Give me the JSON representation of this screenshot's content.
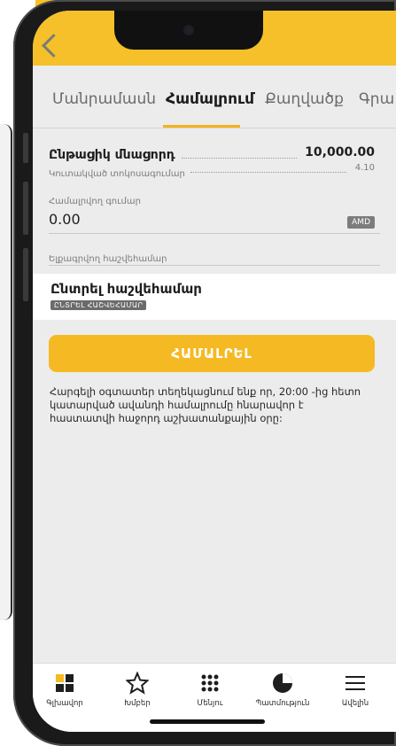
{
  "tabs": [
    {
      "label": "Մանրամասն"
    },
    {
      "label": "Համալրում"
    },
    {
      "label": "Քաղվածք"
    },
    {
      "label": "Գրա"
    }
  ],
  "balance": {
    "label": "Ընթացիկ մնացորդ",
    "value": "10,000.00",
    "rate_label": "Կուտակված տոկոսագումար",
    "rate_value": "4.10"
  },
  "amount": {
    "label": "Համալրվող գումար",
    "value": "0.00",
    "currency": "AMD"
  },
  "debit_account": {
    "label": "Ելքագրվող հաշվեհամար",
    "title": "Ընտրել հաշվեհամար",
    "chip": "ԸՆՏՐԵԼ ՀԱՇՎԵՀԱՄԱՐ"
  },
  "action": {
    "label": "ՀԱՄԱԼՐԵԼ"
  },
  "notice": "Հարգելի օգտատեր տեղեկացնում ենք որ, 20:00 -ից հետո կատարված ավանդի համալրումը հնարավոր է հաստատվի հաջորդ աշխատանքային օրը:",
  "bottom_nav": [
    {
      "label": "Գլխավոր",
      "icon": "home-grid-icon"
    },
    {
      "label": "Խմբեր",
      "icon": "star-icon"
    },
    {
      "label": "Մենյու",
      "icon": "menu-dots-icon"
    },
    {
      "label": "Պատմություն",
      "icon": "history-pie-icon"
    },
    {
      "label": "Ավելին",
      "icon": "hamburger-icon"
    }
  ],
  "colors": {
    "accent": "#f5b923",
    "status_bar": "#f5c02a",
    "background": "#ececec"
  }
}
